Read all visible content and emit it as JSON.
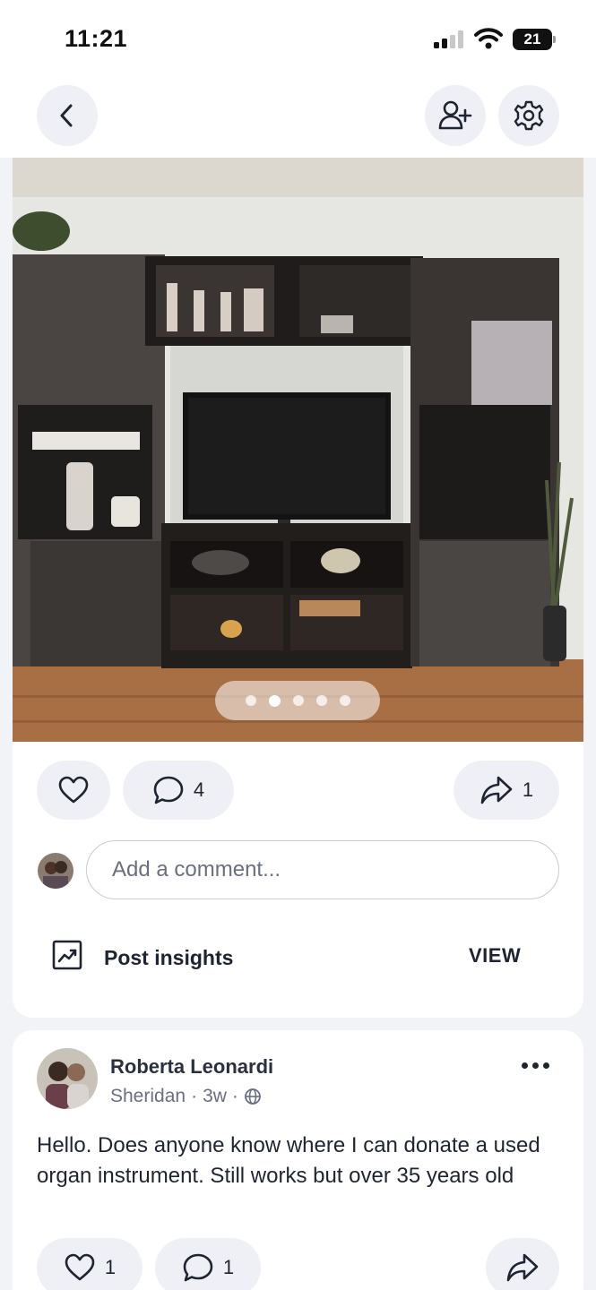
{
  "status": {
    "time": "11:21",
    "battery": "21"
  },
  "icons": {
    "back": "chevron-left-icon",
    "add_user": "add-user-icon",
    "settings": "gear-icon",
    "like": "heart-icon",
    "comment": "comment-icon",
    "share": "share-icon",
    "insights": "trend-chart-icon",
    "globe": "globe-icon",
    "more": "more-horizontal-icon"
  },
  "post": {
    "photo_alt": "TV entertainment unit with glass cabinets",
    "carousel": {
      "total": 5,
      "active": 2
    },
    "comments_count": "4",
    "shares_count": "1",
    "comment_placeholder": "Add a comment...",
    "insights_label": "Post insights",
    "view_label": "VIEW"
  },
  "next_post": {
    "author": "Roberta Leonardi",
    "location": "Sheridan",
    "separator": "·",
    "age": "3w",
    "body": "Hello. Does anyone know where I can donate a used organ instrument.  Still works but over 35 years old",
    "likes_count": "1",
    "comments_count": "1"
  },
  "colors": {
    "pill_bg": "#eef0f5",
    "text_dark": "#1f2432",
    "muted": "#6a6f80",
    "page_bg": "#f2f3f7"
  }
}
